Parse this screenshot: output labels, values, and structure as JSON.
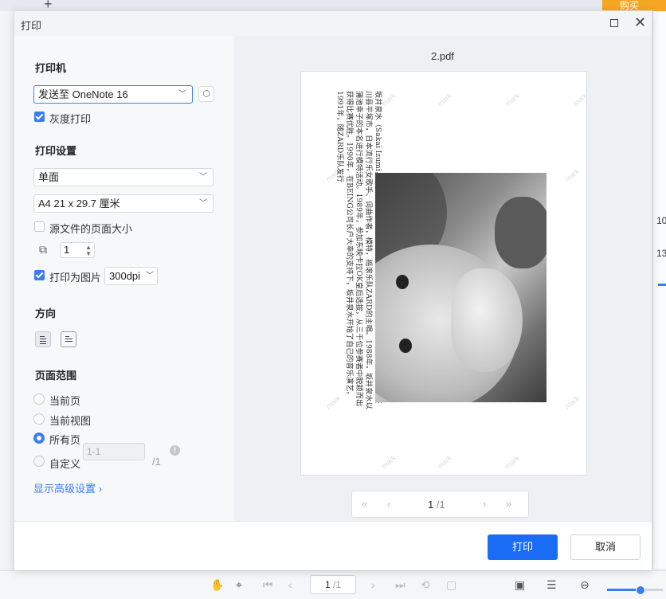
{
  "background": {
    "buy_label": "购买",
    "right_values": [
      "10",
      "13"
    ],
    "bottom_page": {
      "current": "1",
      "total": "/1"
    }
  },
  "dialog": {
    "title": "打印",
    "printer": {
      "heading": "打印机",
      "selected": "发送至 OneNote 16",
      "grayscale_label": "灰度打印"
    },
    "print_settings": {
      "heading": "打印设置",
      "sides": "单面",
      "paper": "A4 21 x 29.7 厘米",
      "source_page_size_label": "源文件的页面大小",
      "copies": "1",
      "print_as_image_label": "打印为图片",
      "dpi": "300dpi"
    },
    "orientation": {
      "heading": "方向"
    },
    "page_range": {
      "heading": "页面范围",
      "options": [
        "当前页",
        "当前视图",
        "所有页",
        "自定义"
      ],
      "custom_placeholder": "1-1",
      "custom_total": "/1"
    },
    "advanced_link": "显示高级设置",
    "preview": {
      "file_name": "2.pdf",
      "page_text": "坂井泉水（Sakai Izumi，1967年2月6日—2007年5月27日），原名蒲池幸子，出生于日本神奈川县平塚市，日本流行乐女歌手、词曲作者，模特，摇滚乐队ZARD的主唱。1988年，坂井泉水以蒲池幸子的本名进行模特活动。1989年，参加东映卡拉OK皇后选拔，从三千位参赛者中脱颖而出获得比赛优胜。1990年，在BEING公司长户大幸的支持下，坂井泉水开始了自己的音乐演艺。1991年，随ZARD乐队发行",
      "watermark": "mark",
      "pager": {
        "current": "1",
        "total": "/1"
      }
    },
    "footer": {
      "print_label": "打印",
      "cancel_label": "取消"
    }
  }
}
